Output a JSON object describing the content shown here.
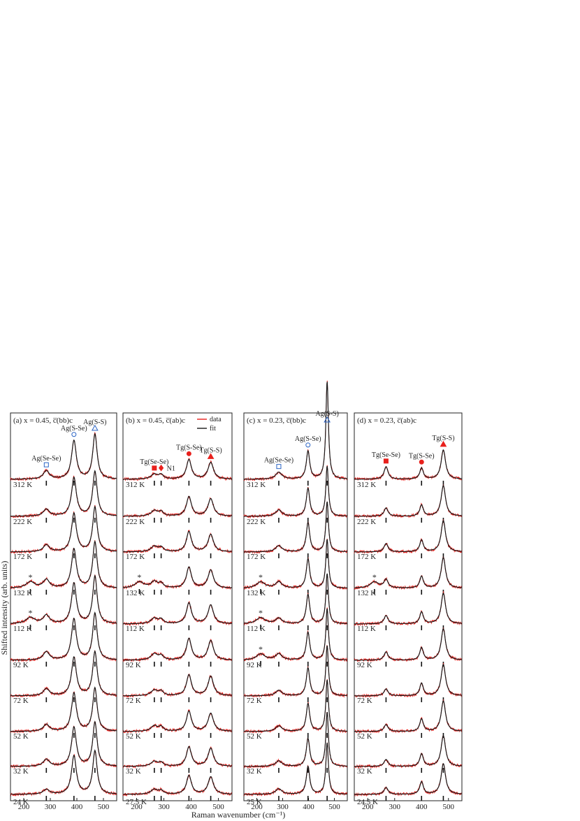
{
  "figure": {
    "ylabel": "Shifted intensity (arb. units)",
    "xlabel": "Raman wavenumber (cm⁻¹)",
    "colors": {
      "data": "#e8201c",
      "fit": "#1a1a1a",
      "marker_blue": "#2a63c4",
      "marker_red": "#e8201c",
      "tick": "#111111"
    }
  },
  "chart_data": [
    {
      "panel": "a",
      "type": "line",
      "title": "(a) x = 0.45, c̅(bb)c",
      "xlim": [
        150,
        550
      ],
      "xticks": [
        200,
        300,
        400,
        500
      ],
      "temperatures": [
        "312 K",
        "222 K",
        "172 K",
        "132 K",
        "112 K",
        "92 K",
        "72 K",
        "52 K",
        "32 K",
        "24 K"
      ],
      "peaks": [
        {
          "label": "Ag(Se-Se)",
          "position": 285,
          "marker": "open-square",
          "color": "#2a63c4"
        },
        {
          "label": "Ag(S-Se)",
          "position": 389,
          "marker": "open-circle",
          "color": "#2a63c4"
        },
        {
          "label": "Ag(S-S)",
          "position": 468,
          "marker": "open-triangle",
          "color": "#2a63c4"
        }
      ],
      "extra_markers": [
        {
          "symbol": "*",
          "position": 225,
          "temperatures": [
            "132 K",
            "112 K"
          ]
        }
      ],
      "legend": []
    },
    {
      "panel": "b",
      "type": "line",
      "title": "(b) x = 0.45, c̅(ab)c",
      "xlim": [
        150,
        550
      ],
      "xticks": [
        200,
        300,
        400,
        500
      ],
      "temperatures": [
        "312 K",
        "222 K",
        "172 K",
        "132 K",
        "112 K",
        "92 K",
        "72 K",
        "52 K",
        "32 K",
        "27.5 K"
      ],
      "peaks": [
        {
          "label": "Tg(Se-Se)",
          "position": 265,
          "marker": "filled-square",
          "color": "#e8201c"
        },
        {
          "label": "N1",
          "position": 290,
          "marker": "filled-diamond",
          "color": "#e8201c"
        },
        {
          "label": "Tg(S-Se)",
          "position": 392,
          "marker": "filled-circle",
          "color": "#e8201c"
        },
        {
          "label": "Tg(S-S)",
          "position": 472,
          "marker": "filled-triangle",
          "color": "#e8201c"
        }
      ],
      "extra_markers": [
        {
          "symbol": "*",
          "position": 210,
          "temperatures": [
            "132 K"
          ]
        }
      ],
      "legend": [
        "data",
        "fit"
      ]
    },
    {
      "panel": "c",
      "type": "line",
      "title": "(c) x = 0.23, c̅(bb)c",
      "xlim": [
        150,
        550
      ],
      "xticks": [
        200,
        300,
        400,
        500
      ],
      "temperatures": [
        "312 K",
        "222 K",
        "172 K",
        "132 K",
        "112 K",
        "92 K",
        "72 K",
        "52 K",
        "32 K",
        "25 K"
      ],
      "peaks": [
        {
          "label": "Ag(Se-Se)",
          "position": 285,
          "marker": "open-square",
          "color": "#2a63c4"
        },
        {
          "label": "Ag(S-Se)",
          "position": 398,
          "marker": "open-circle",
          "color": "#2a63c4"
        },
        {
          "label": "Ag(S-S)",
          "position": 472,
          "marker": "open-triangle",
          "color": "#2a63c4"
        }
      ],
      "extra_markers": [
        {
          "symbol": "*",
          "position": 215,
          "temperatures": [
            "132 K",
            "112 K",
            "92 K"
          ]
        }
      ],
      "legend": []
    },
    {
      "panel": "d",
      "type": "line",
      "title": "(d) x = 0.23, c̅(ab)c",
      "xlim": [
        150,
        550
      ],
      "xticks": [
        200,
        300,
        400,
        500
      ],
      "temperatures": [
        "312 K",
        "222 K",
        "172 K",
        "132 K",
        "112 K",
        "92 K",
        "72 K",
        "52 K",
        "32 K",
        "24.5 K"
      ],
      "peaks": [
        {
          "label": "Tg(Se-Se)",
          "position": 268,
          "marker": "filled-square",
          "color": "#e8201c"
        },
        {
          "label": "Tg(S-Se)",
          "position": 400,
          "marker": "filled-circle",
          "color": "#e8201c"
        },
        {
          "label": "Tg(S-S)",
          "position": 481,
          "marker": "filled-triangle",
          "color": "#e8201c"
        }
      ],
      "extra_markers": [
        {
          "symbol": "*",
          "position": 225,
          "temperatures": [
            "132 K"
          ]
        }
      ],
      "legend": []
    }
  ]
}
